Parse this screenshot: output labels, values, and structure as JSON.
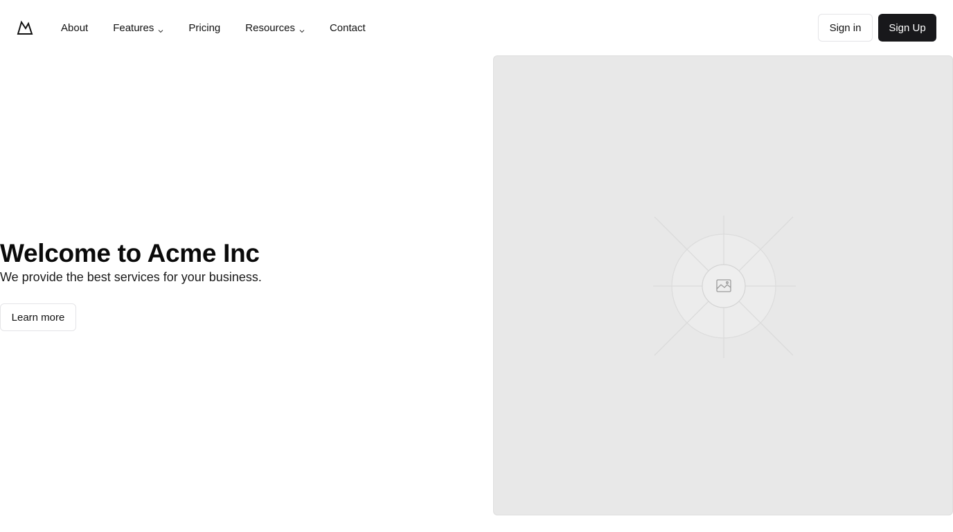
{
  "header": {
    "logo_icon": "mountain-logo-icon",
    "nav": [
      {
        "label": "About",
        "has_dropdown": false
      },
      {
        "label": "Features",
        "has_dropdown": true
      },
      {
        "label": "Pricing",
        "has_dropdown": false
      },
      {
        "label": "Resources",
        "has_dropdown": true
      },
      {
        "label": "Contact",
        "has_dropdown": false
      }
    ],
    "sign_in_label": "Sign in",
    "sign_up_label": "Sign Up"
  },
  "hero": {
    "title": "Welcome to Acme Inc",
    "subtitle": "We provide the best services for your business.",
    "cta_label": "Learn more",
    "image_icon": "image-placeholder-icon"
  },
  "colors": {
    "primary_button_bg": "#18181b",
    "primary_button_text": "#ffffff",
    "placeholder_bg": "#e8e8e8",
    "border": "#e4e4e7"
  }
}
